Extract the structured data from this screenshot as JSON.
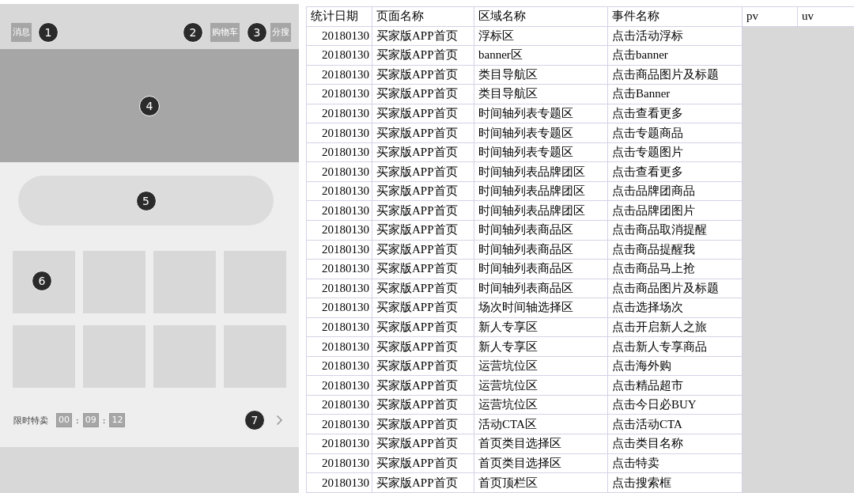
{
  "mockup": {
    "top_bar": {
      "buttons": [
        {
          "label": "消息",
          "marker": "1"
        },
        {
          "label": "购物车",
          "marker": "2"
        },
        {
          "label": "分搜",
          "marker": "3"
        }
      ]
    },
    "banner": {
      "marker": "4"
    },
    "search_pill": {
      "marker": "5"
    },
    "category_grid": {
      "marker": "6"
    },
    "flash_sale": {
      "label": "限时特卖",
      "marker": "7",
      "time_parts": [
        {
          "kind": "digits",
          "text": "00"
        },
        {
          "kind": "separator",
          "text": ":"
        },
        {
          "kind": "digits",
          "text": "09"
        },
        {
          "kind": "separator",
          "text": ":"
        },
        {
          "kind": "digits",
          "text": "12"
        }
      ]
    }
  },
  "table": {
    "columns": [
      "统计日期",
      "页面名称",
      "区域名称",
      "事件名称",
      "pv",
      "uv"
    ],
    "rows": [
      [
        "20180130",
        "买家版APP首页",
        "浮标区",
        "点击活动浮标"
      ],
      [
        "20180130",
        "买家版APP首页",
        "banner区",
        "点击banner"
      ],
      [
        "20180130",
        "买家版APP首页",
        "类目导航区",
        "点击商品图片及标题"
      ],
      [
        "20180130",
        "买家版APP首页",
        "类目导航区",
        "点击Banner"
      ],
      [
        "20180130",
        "买家版APP首页",
        "时间轴列表专题区",
        "点击查看更多"
      ],
      [
        "20180130",
        "买家版APP首页",
        "时间轴列表专题区",
        "点击专题商品"
      ],
      [
        "20180130",
        "买家版APP首页",
        "时间轴列表专题区",
        "点击专题图片"
      ],
      [
        "20180130",
        "买家版APP首页",
        "时间轴列表品牌团区",
        "点击查看更多"
      ],
      [
        "20180130",
        "买家版APP首页",
        "时间轴列表品牌团区",
        "点击品牌团商品"
      ],
      [
        "20180130",
        "买家版APP首页",
        "时间轴列表品牌团区",
        "点击品牌团图片"
      ],
      [
        "20180130",
        "买家版APP首页",
        "时间轴列表商品区",
        "点击商品取消提醒"
      ],
      [
        "20180130",
        "买家版APP首页",
        "时间轴列表商品区",
        "点击商品提醒我"
      ],
      [
        "20180130",
        "买家版APP首页",
        "时间轴列表商品区",
        "点击商品马上抢"
      ],
      [
        "20180130",
        "买家版APP首页",
        "时间轴列表商品区",
        "点击商品图片及标题"
      ],
      [
        "20180130",
        "买家版APP首页",
        "场次时间轴选择区",
        "点击选择场次"
      ],
      [
        "20180130",
        "买家版APP首页",
        "新人专享区",
        "点击开启新人之旅"
      ],
      [
        "20180130",
        "买家版APP首页",
        "新人专享区",
        "点击新人专享商品"
      ],
      [
        "20180130",
        "买家版APP首页",
        "运营坑位区",
        "点击海外购"
      ],
      [
        "20180130",
        "买家版APP首页",
        "运营坑位区",
        "点击精品超市"
      ],
      [
        "20180130",
        "买家版APP首页",
        "运营坑位区",
        "点击今日必BUY"
      ],
      [
        "20180130",
        "买家版APP首页",
        "活动CTA区",
        "点击活动CTA"
      ],
      [
        "20180130",
        "买家版APP首页",
        "首页类目选择区",
        "点击类目名称"
      ],
      [
        "20180130",
        "买家版APP首页",
        "首页类目选择区",
        "点击特卖"
      ],
      [
        "20180130",
        "买家版APP首页",
        "首页顶栏区",
        "点击搜索框"
      ]
    ]
  }
}
